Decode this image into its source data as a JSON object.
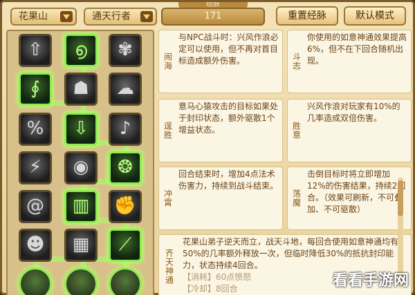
{
  "toolbar": {
    "sect_dropdown": "花果山",
    "path_dropdown": "通天行者",
    "level_value": "171",
    "level_tab": "经脉",
    "reset_button": "重置经脉",
    "default_button": "默认模式"
  },
  "skills": [
    {
      "tag": "闹海",
      "desc": "与NPC战斗时：兴风作浪必定可以使用，但不再对首目标造成额外伤害。"
    },
    {
      "tag": "斗志",
      "desc": "你使用的如意神通效果提高6%，但不在下回合随机出现。"
    },
    {
      "tag": "逞胜",
      "desc": "意马心猿攻击的目标如果处于封印状态，额外驱散1个增益状态。"
    },
    {
      "tag": "胜意",
      "desc": "兴风作浪对玩家有10%的几率造成双倍伤害。"
    },
    {
      "tag": "冲霄",
      "desc": "回合结束时，增加4点法术伤害力，持续到战斗结束。"
    },
    {
      "tag": "荡魔",
      "desc": "击倒目标时将立即增加12%的伤害结果，持续2回合。（效果可刷新，不可叠加、不可驱散）"
    }
  ],
  "ultimate": {
    "tag": "齐天神通",
    "desc": "花果山弟子逆天而立，战天斗地，每回合使用如意神通均有50%的几率额外释放一次，但临时降低30%的抵抗封印能力，状态持续4回合。",
    "cost": "【消耗】60点愤怒",
    "cooldown": "【冷却】8回合"
  },
  "watermark": "看看手游网",
  "nodes": [
    {
      "icon": "arrow-up-icon",
      "glyph": "⇧",
      "active": false
    },
    {
      "icon": "swirl-wave-icon",
      "glyph": "൭",
      "active": true
    },
    {
      "icon": "monkey-icon",
      "glyph": "✾",
      "active": false
    },
    {
      "icon": "tornado-fist-icon",
      "glyph": "∮",
      "active": true
    },
    {
      "icon": "shield-face-icon",
      "glyph": "☗",
      "active": false
    },
    {
      "icon": "cloud-swirl-icon",
      "glyph": "☁",
      "active": false
    },
    {
      "icon": "percent-burst-icon",
      "glyph": "%",
      "active": false
    },
    {
      "icon": "downward-strike-icon",
      "glyph": "⇩",
      "active": true
    },
    {
      "icon": "music-note-icon",
      "glyph": "♪",
      "active": false
    },
    {
      "icon": "claw-slash-icon",
      "glyph": "⚡",
      "active": false
    },
    {
      "icon": "eye-icon",
      "glyph": "◉",
      "active": false
    },
    {
      "icon": "vortex-icon",
      "glyph": "❂",
      "active": true
    },
    {
      "icon": "spiral-icon",
      "glyph": "@",
      "active": false
    },
    {
      "icon": "pillar-icon",
      "glyph": "▥",
      "active": true
    },
    {
      "icon": "fist-icon",
      "glyph": "✊",
      "active": false
    },
    {
      "icon": "mask-icon",
      "glyph": "☻",
      "active": false
    },
    {
      "icon": "cage-icon",
      "glyph": "▦",
      "active": false
    },
    {
      "icon": "staff-strike-icon",
      "glyph": "⟋",
      "active": true
    }
  ]
}
